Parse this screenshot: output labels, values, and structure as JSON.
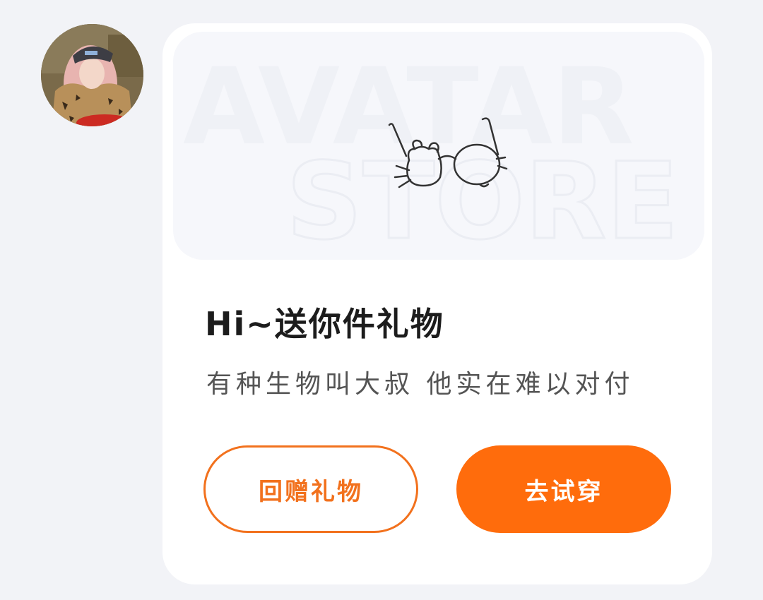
{
  "sender": {
    "avatar_icon": "user-avatar-photo"
  },
  "gift_card": {
    "banner": {
      "watermark_line1": "AVATAR",
      "watermark_line2": "STORE",
      "item_icon": "glasses-icon"
    },
    "title": "Hi~送你件礼物",
    "message": "有种生物叫大叔 他实在难以对付",
    "buttons": {
      "return_gift": "回赠礼物",
      "try_on": "去试穿"
    }
  },
  "colors": {
    "accent": "#ff6c0c",
    "accent_outline": "#f2711d",
    "page_background": "#f2f3f7",
    "card_background": "#ffffff"
  }
}
